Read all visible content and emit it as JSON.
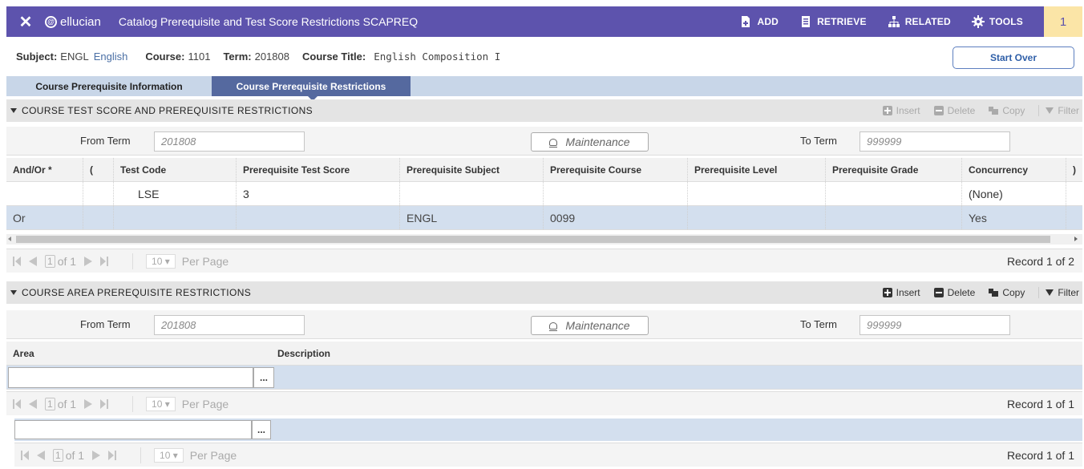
{
  "header": {
    "close": "✕",
    "logo": "ellucian",
    "title": "Catalog Prerequisite and Test Score Restrictions SCAPREQ",
    "add": "ADD",
    "retrieve": "RETRIEVE",
    "related": "RELATED",
    "tools": "TOOLS",
    "badge": "1"
  },
  "key_block": {
    "subject_label": "Subject:",
    "subject_value": "ENGL",
    "subject_desc": "English",
    "course_label": "Course:",
    "course_value": "1101",
    "term_label": "Term:",
    "term_value": "201808",
    "title_label": "Course Title:",
    "title_value": "English Composition I",
    "start_over": "Start Over"
  },
  "tabs": [
    {
      "label": "Course Prerequisite Information",
      "active": false
    },
    {
      "label": "Course Prerequisite Restrictions",
      "active": true
    }
  ],
  "section1": {
    "title": "COURSE TEST SCORE AND PREREQUISITE RESTRICTIONS",
    "insert": "Insert",
    "delete": "Delete",
    "copy": "Copy",
    "filter": "Filter",
    "from_term_label": "From Term",
    "from_term_value": "201808",
    "maintenance": "Maintenance",
    "to_term_label": "To Term",
    "to_term_value": "999999",
    "columns": [
      "And/Or *",
      "(",
      "Test Code",
      "Prerequisite Test Score",
      "Prerequisite Subject",
      "Prerequisite Course",
      "Prerequisite Level",
      "Prerequisite Grade",
      "Concurrency",
      ")"
    ],
    "rows": [
      [
        "",
        "",
        "LSE",
        "3",
        "",
        "",
        "",
        "",
        "(None)",
        ""
      ],
      [
        "Or",
        "",
        "",
        "",
        "ENGL",
        "0099",
        "",
        "",
        "Yes",
        ""
      ]
    ],
    "pager": {
      "page": "1",
      "of": "of 1",
      "per_page": "10",
      "per_page_label": "Per Page",
      "record": "Record 1 of 2"
    }
  },
  "section2": {
    "title": "COURSE AREA PREREQUISITE RESTRICTIONS",
    "insert": "Insert",
    "delete": "Delete",
    "copy": "Copy",
    "filter": "Filter",
    "from_term_label": "From Term",
    "from_term_value": "201808",
    "maintenance": "Maintenance",
    "to_term_label": "To Term",
    "to_term_value": "999999",
    "columns": [
      "Area",
      "Description"
    ],
    "dots": "...",
    "pager": {
      "page": "1",
      "of": "of 1",
      "per_page": "10",
      "per_page_label": "Per Page",
      "record": "Record 1 of 1"
    }
  },
  "section3": {
    "dots": "...",
    "pager": {
      "page": "1",
      "of": "of 1",
      "per_page": "10",
      "per_page_label": "Per Page",
      "record": "Record 1 of 1"
    }
  },
  "colors": {
    "header": "#5d53ad",
    "badge": "#fbe5a7",
    "active_tab": "#55699f",
    "alt_row": "#d3dfee"
  }
}
